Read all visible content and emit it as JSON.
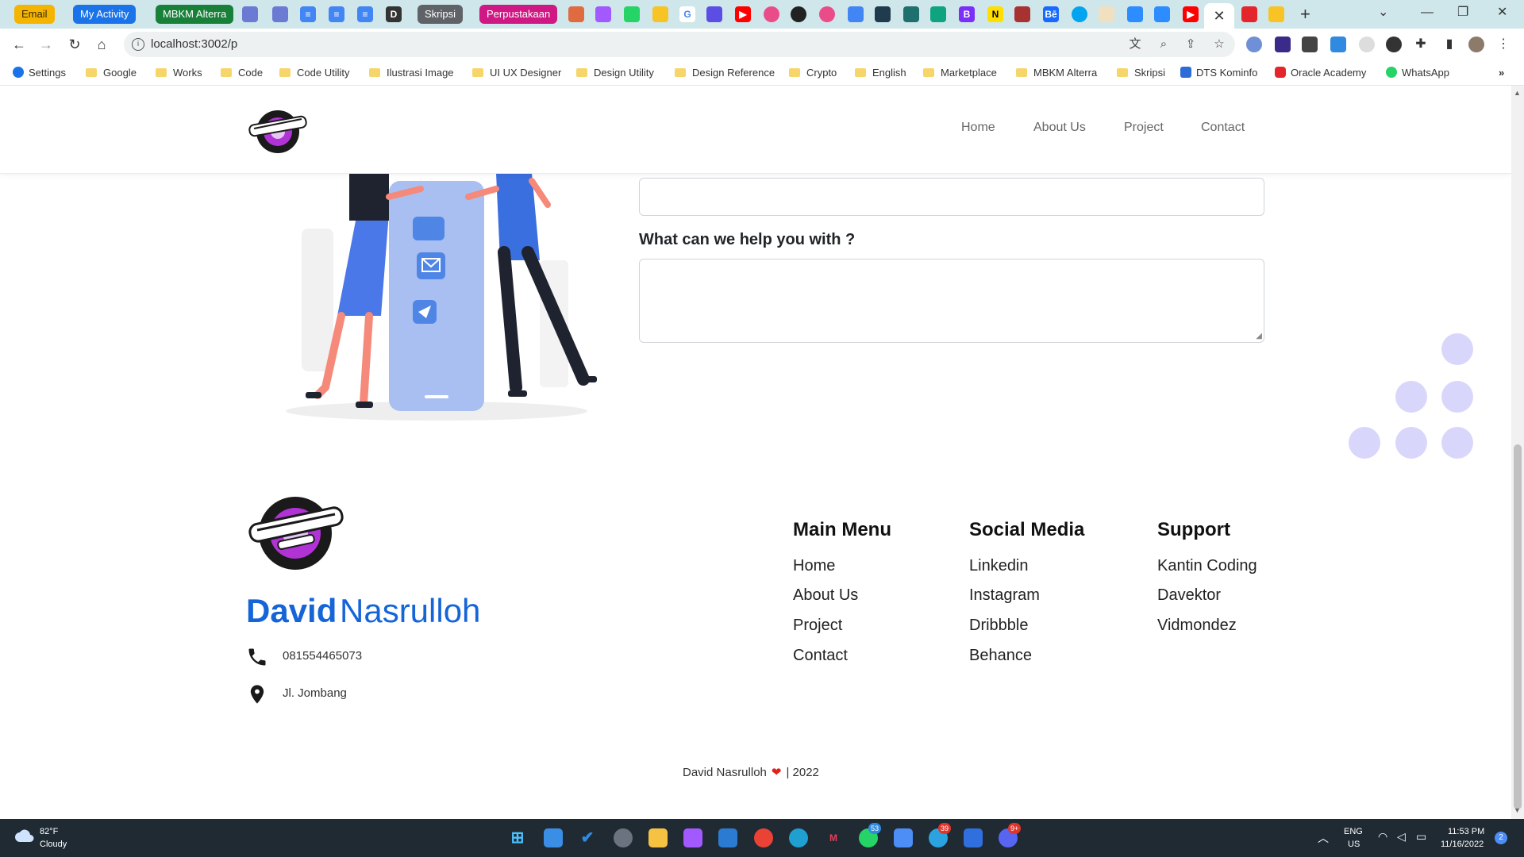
{
  "browser": {
    "tab_chips": [
      {
        "label": "Email",
        "color": "#f4b400",
        "text_color": "#3a2a00"
      },
      {
        "label": "My Activity",
        "color": "#1a73e8",
        "text_color": "#ffffff"
      },
      {
        "label": "MBKM Alterra",
        "color": "#188038",
        "text_color": "#ffffff"
      },
      {
        "label": "Skripsi",
        "color": "#5f6368",
        "text_color": "#ffffff"
      },
      {
        "label": "Perpustakaan",
        "color": "#d01884",
        "text_color": "#ffffff"
      }
    ],
    "active_tab_close": "✕",
    "new_tab_icon": "+",
    "url": "localhost:3002/p",
    "bookmarks": [
      {
        "label": "Settings",
        "kind": "settings"
      },
      {
        "label": "Google",
        "kind": "folder"
      },
      {
        "label": "Works",
        "kind": "folder"
      },
      {
        "label": "Code",
        "kind": "folder"
      },
      {
        "label": "Code Utility",
        "kind": "folder"
      },
      {
        "label": "Ilustrasi Image",
        "kind": "folder"
      },
      {
        "label": "UI UX Designer",
        "kind": "folder"
      },
      {
        "label": "Design Utility",
        "kind": "folder"
      },
      {
        "label": "Design Reference",
        "kind": "folder"
      },
      {
        "label": "Crypto",
        "kind": "folder"
      },
      {
        "label": "English",
        "kind": "folder"
      },
      {
        "label": "Marketplace",
        "kind": "folder"
      },
      {
        "label": "MBKM Alterra",
        "kind": "folder"
      },
      {
        "label": "Skripsi",
        "kind": "folder"
      },
      {
        "label": "DTS Kominfo",
        "kind": "site"
      },
      {
        "label": "Oracle Academy",
        "kind": "site"
      },
      {
        "label": "WhatsApp",
        "kind": "site"
      }
    ],
    "bookmarks_overflow": "»"
  },
  "header": {
    "nav": [
      "Home",
      "About Us",
      "Project",
      "Contact"
    ]
  },
  "form": {
    "help_label": "What can we help you with ?",
    "help_value": ""
  },
  "footer": {
    "brand_first": "David",
    "brand_last": "Nasrulloh",
    "phone": "081554465073",
    "address": "Jl. Jombang",
    "columns": [
      {
        "title": "Main Menu",
        "links": [
          "Home",
          "About Us",
          "Project",
          "Contact"
        ]
      },
      {
        "title": "Social Media",
        "links": [
          "Linkedin",
          "Instagram",
          "Dribbble",
          "Behance"
        ]
      },
      {
        "title": "Support",
        "links": [
          "Kantin Coding",
          "Davektor",
          "Vidmondez"
        ]
      }
    ],
    "copyright_name": "David Nasrulloh",
    "copyright_year": "| 2022",
    "accent_color": "#1565d8"
  },
  "taskbar": {
    "weather_temp": "82°F",
    "weather_desc": "Cloudy",
    "lang_1": "ENG",
    "lang_2": "US",
    "time": "11:53 PM",
    "date": "11/16/2022",
    "notifications": "2",
    "badges": {
      "whatsapp": "53",
      "telegram": "39",
      "discord": "9+"
    }
  }
}
